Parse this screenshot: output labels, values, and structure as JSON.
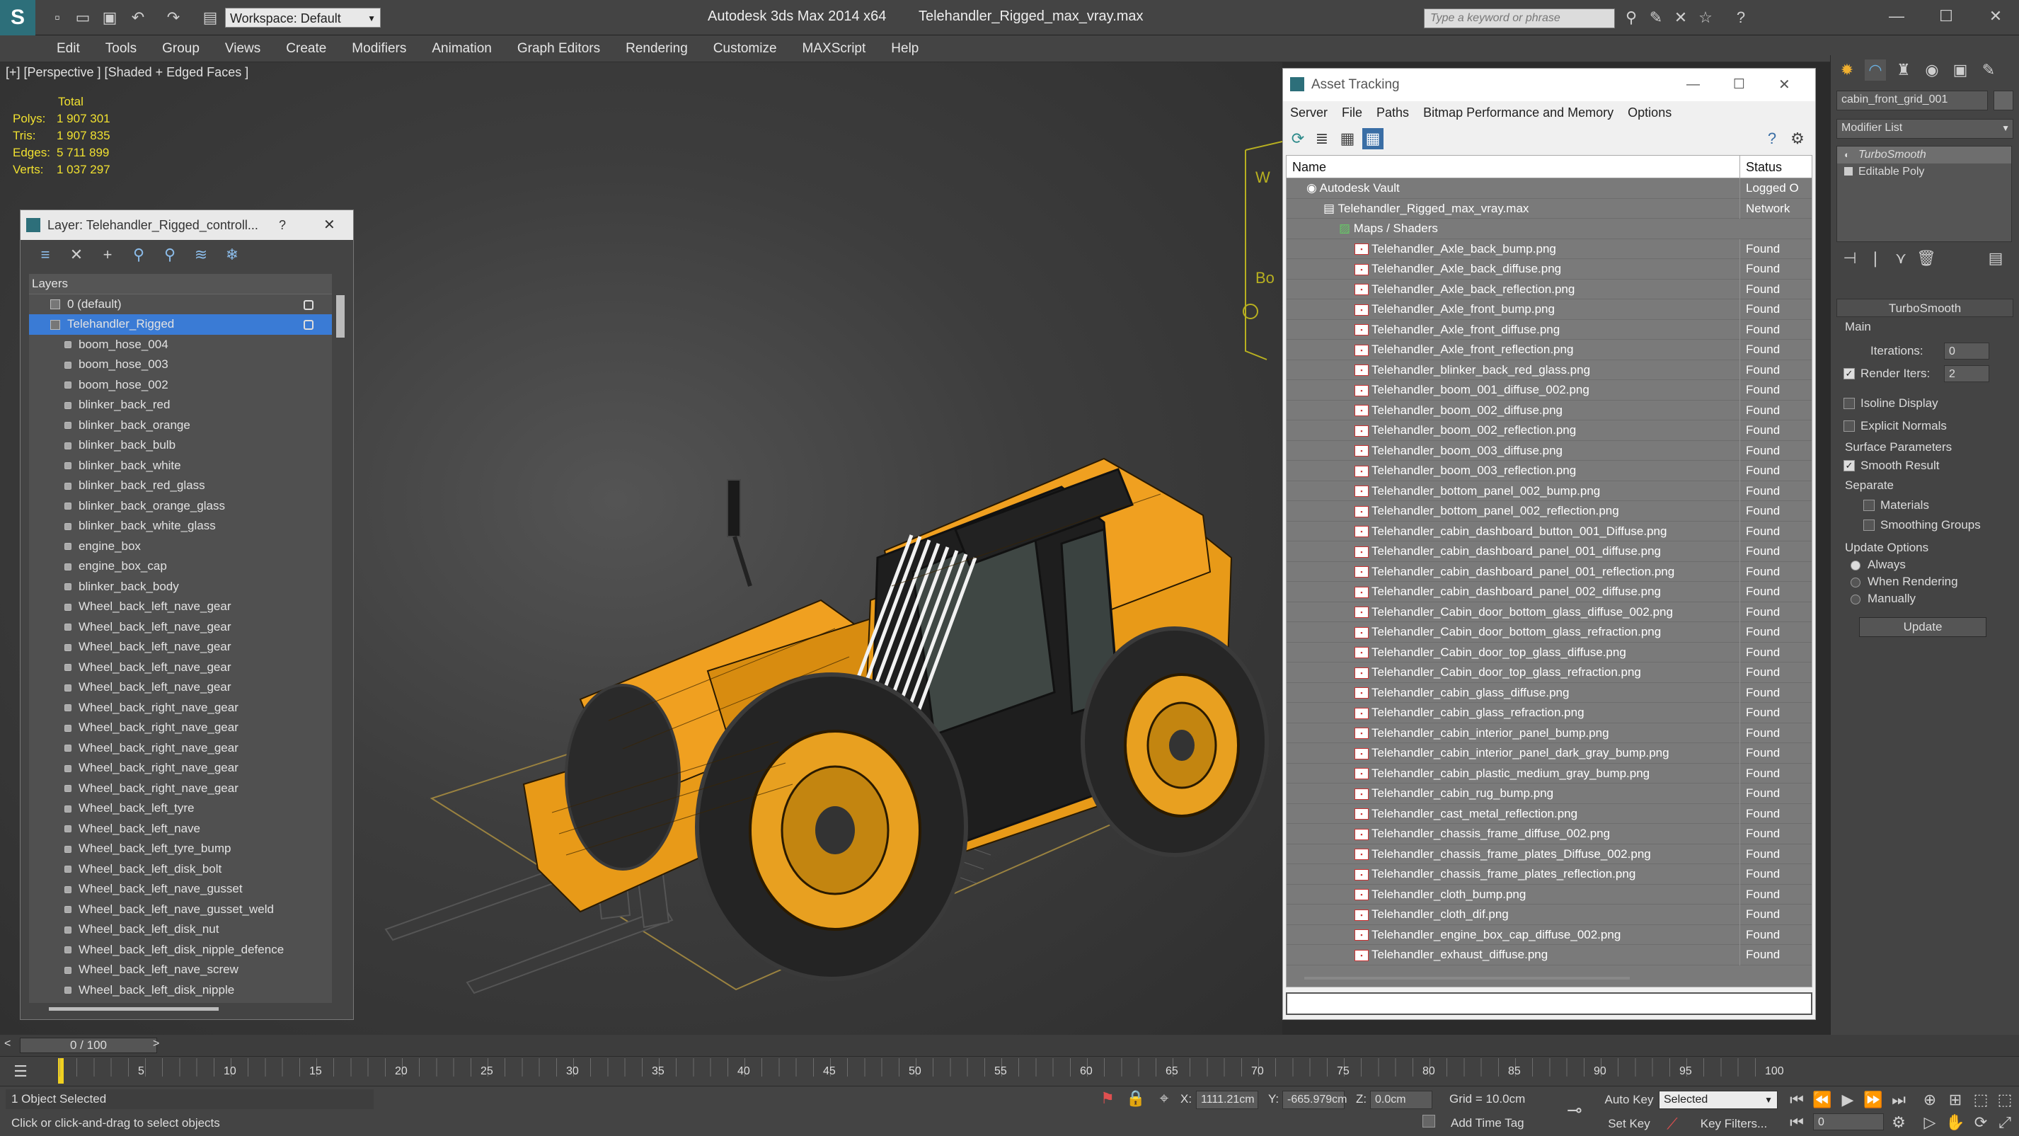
{
  "app": {
    "title": "Autodesk 3ds Max  2014 x64",
    "file": "Telehandler_Rigged_max_vray.max",
    "workspace": "Workspace: Default",
    "search_placeholder": "Type a keyword or phrase"
  },
  "menus": [
    "Edit",
    "Tools",
    "Group",
    "Views",
    "Create",
    "Modifiers",
    "Animation",
    "Graph Editors",
    "Rendering",
    "Customize",
    "MAXScript",
    "Help"
  ],
  "viewport": {
    "label": "[+] [Perspective ] [Shaded + Edged Faces ]",
    "stats_header": "Total",
    "stats": [
      {
        "k": "Polys:",
        "v": "1 907 301"
      },
      {
        "k": "Tris:",
        "v": "1 907 835"
      },
      {
        "k": "Edges:",
        "v": "5 711 899"
      },
      {
        "k": "Verts:",
        "v": "1 037 297"
      }
    ]
  },
  "layer_panel": {
    "title": "Layer: Telehandler_Rigged_controll...",
    "help": "?",
    "header": "Layers",
    "rows": [
      {
        "label": "0 (default)",
        "level": 0,
        "selected": false
      },
      {
        "label": "Telehandler_Rigged",
        "level": 0,
        "selected": true
      },
      {
        "label": "boom_hose_004",
        "level": 1
      },
      {
        "label": "boom_hose_003",
        "level": 1
      },
      {
        "label": "boom_hose_002",
        "level": 1
      },
      {
        "label": "blinker_back_red",
        "level": 1
      },
      {
        "label": "blinker_back_orange",
        "level": 1
      },
      {
        "label": "blinker_back_bulb",
        "level": 1
      },
      {
        "label": "blinker_back_white",
        "level": 1
      },
      {
        "label": "blinker_back_red_glass",
        "level": 1
      },
      {
        "label": "blinker_back_orange_glass",
        "level": 1
      },
      {
        "label": "blinker_back_white_glass",
        "level": 1
      },
      {
        "label": "engine_box",
        "level": 1
      },
      {
        "label": "engine_box_cap",
        "level": 1
      },
      {
        "label": "blinker_back_body",
        "level": 1
      },
      {
        "label": "Wheel_back_left_nave_gear",
        "level": 1
      },
      {
        "label": "Wheel_back_left_nave_gear",
        "level": 1
      },
      {
        "label": "Wheel_back_left_nave_gear",
        "level": 1
      },
      {
        "label": "Wheel_back_left_nave_gear",
        "level": 1
      },
      {
        "label": "Wheel_back_left_nave_gear",
        "level": 1
      },
      {
        "label": "Wheel_back_right_nave_gear",
        "level": 1
      },
      {
        "label": "Wheel_back_right_nave_gear",
        "level": 1
      },
      {
        "label": "Wheel_back_right_nave_gear",
        "level": 1
      },
      {
        "label": "Wheel_back_right_nave_gear",
        "level": 1
      },
      {
        "label": "Wheel_back_right_nave_gear",
        "level": 1
      },
      {
        "label": "Wheel_back_left_tyre",
        "level": 1
      },
      {
        "label": "Wheel_back_left_nave",
        "level": 1
      },
      {
        "label": "Wheel_back_left_tyre_bump",
        "level": 1
      },
      {
        "label": "Wheel_back_left_disk_bolt",
        "level": 1
      },
      {
        "label": "Wheel_back_left_nave_gusset",
        "level": 1
      },
      {
        "label": "Wheel_back_left_nave_gusset_weld",
        "level": 1
      },
      {
        "label": "Wheel_back_left_disk_nut",
        "level": 1
      },
      {
        "label": "Wheel_back_left_disk_nipple_defence",
        "level": 1
      },
      {
        "label": "Wheel_back_left_nave_screw",
        "level": 1
      },
      {
        "label": "Wheel_back_left_disk_nipple",
        "level": 1
      }
    ]
  },
  "asset_tracking": {
    "title": "Asset Tracking",
    "menus": [
      "Server",
      "File",
      "Paths",
      "Bitmap Performance and Memory",
      "Options"
    ],
    "col_name": "Name",
    "col_status": "Status",
    "rows": [
      {
        "name": "Autodesk Vault",
        "status": "Logged O",
        "level": 0,
        "kind": "vault"
      },
      {
        "name": "Telehandler_Rigged_max_vray.max",
        "status": "Network",
        "level": 1,
        "kind": "file"
      },
      {
        "name": "Maps / Shaders",
        "status": "",
        "level": 2,
        "kind": "maps"
      },
      {
        "name": "Telehandler_Axle_back_bump.png",
        "status": "Found",
        "level": 3,
        "kind": "png"
      },
      {
        "name": "Telehandler_Axle_back_diffuse.png",
        "status": "Found",
        "level": 3,
        "kind": "png"
      },
      {
        "name": "Telehandler_Axle_back_reflection.png",
        "status": "Found",
        "level": 3,
        "kind": "png"
      },
      {
        "name": "Telehandler_Axle_front_bump.png",
        "status": "Found",
        "level": 3,
        "kind": "png"
      },
      {
        "name": "Telehandler_Axle_front_diffuse.png",
        "status": "Found",
        "level": 3,
        "kind": "png"
      },
      {
        "name": "Telehandler_Axle_front_reflection.png",
        "status": "Found",
        "level": 3,
        "kind": "png"
      },
      {
        "name": "Telehandler_blinker_back_red_glass.png",
        "status": "Found",
        "level": 3,
        "kind": "png"
      },
      {
        "name": "Telehandler_boom_001_diffuse_002.png",
        "status": "Found",
        "level": 3,
        "kind": "png"
      },
      {
        "name": "Telehandler_boom_002_diffuse.png",
        "status": "Found",
        "level": 3,
        "kind": "png"
      },
      {
        "name": "Telehandler_boom_002_reflection.png",
        "status": "Found",
        "level": 3,
        "kind": "png"
      },
      {
        "name": "Telehandler_boom_003_diffuse.png",
        "status": "Found",
        "level": 3,
        "kind": "png"
      },
      {
        "name": "Telehandler_boom_003_reflection.png",
        "status": "Found",
        "level": 3,
        "kind": "png"
      },
      {
        "name": "Telehandler_bottom_panel_002_bump.png",
        "status": "Found",
        "level": 3,
        "kind": "png"
      },
      {
        "name": "Telehandler_bottom_panel_002_reflection.png",
        "status": "Found",
        "level": 3,
        "kind": "png"
      },
      {
        "name": "Telehandler_cabin_dashboard_button_001_Diffuse.png",
        "status": "Found",
        "level": 3,
        "kind": "png"
      },
      {
        "name": "Telehandler_cabin_dashboard_panel_001_diffuse.png",
        "status": "Found",
        "level": 3,
        "kind": "png"
      },
      {
        "name": "Telehandler_cabin_dashboard_panel_001_reflection.png",
        "status": "Found",
        "level": 3,
        "kind": "png"
      },
      {
        "name": "Telehandler_cabin_dashboard_panel_002_diffuse.png",
        "status": "Found",
        "level": 3,
        "kind": "png"
      },
      {
        "name": "Telehandler_Cabin_door_bottom_glass_diffuse_002.png",
        "status": "Found",
        "level": 3,
        "kind": "png"
      },
      {
        "name": "Telehandler_Cabin_door_bottom_glass_refraction.png",
        "status": "Found",
        "level": 3,
        "kind": "png"
      },
      {
        "name": "Telehandler_Cabin_door_top_glass_diffuse.png",
        "status": "Found",
        "level": 3,
        "kind": "png"
      },
      {
        "name": "Telehandler_Cabin_door_top_glass_refraction.png",
        "status": "Found",
        "level": 3,
        "kind": "png"
      },
      {
        "name": "Telehandler_cabin_glass_diffuse.png",
        "status": "Found",
        "level": 3,
        "kind": "png"
      },
      {
        "name": "Telehandler_cabin_glass_refraction.png",
        "status": "Found",
        "level": 3,
        "kind": "png"
      },
      {
        "name": "Telehandler_cabin_interior_panel_bump.png",
        "status": "Found",
        "level": 3,
        "kind": "png"
      },
      {
        "name": "Telehandler_cabin_interior_panel_dark_gray_bump.png",
        "status": "Found",
        "level": 3,
        "kind": "png"
      },
      {
        "name": "Telehandler_cabin_plastic_medium_gray_bump.png",
        "status": "Found",
        "level": 3,
        "kind": "png"
      },
      {
        "name": "Telehandler_cabin_rug_bump.png",
        "status": "Found",
        "level": 3,
        "kind": "png"
      },
      {
        "name": "Telehandler_cast_metal_reflection.png",
        "status": "Found",
        "level": 3,
        "kind": "png"
      },
      {
        "name": "Telehandler_chassis_frame_diffuse_002.png",
        "status": "Found",
        "level": 3,
        "kind": "png"
      },
      {
        "name": "Telehandler_chassis_frame_plates_Diffuse_002.png",
        "status": "Found",
        "level": 3,
        "kind": "png"
      },
      {
        "name": "Telehandler_chassis_frame_plates_reflection.png",
        "status": "Found",
        "level": 3,
        "kind": "png"
      },
      {
        "name": "Telehandler_cloth_bump.png",
        "status": "Found",
        "level": 3,
        "kind": "png"
      },
      {
        "name": "Telehandler_cloth_dif.png",
        "status": "Found",
        "level": 3,
        "kind": "png"
      },
      {
        "name": "Telehandler_engine_box_cap_diffuse_002.png",
        "status": "Found",
        "level": 3,
        "kind": "png"
      },
      {
        "name": "Telehandler_exhaust_diffuse.png",
        "status": "Found",
        "level": 3,
        "kind": "png"
      }
    ]
  },
  "command_panel": {
    "object_name": "cabin_front_grid_001",
    "modifier_list": "Modifier List",
    "stack": [
      "TurboSmooth",
      "Editable Poly"
    ],
    "rollout_title": "TurboSmooth",
    "main_group": "Main",
    "iterations_label": "Iterations:",
    "iterations_value": "0",
    "render_iters_label": "Render Iters:",
    "render_iters_value": "2",
    "isoline_label": "Isoline Display",
    "explicit_label": "Explicit Normals",
    "surface_group": "Surface Parameters",
    "smooth_result": "Smooth Result",
    "separate_label": "Separate",
    "materials": "Materials",
    "smoothing_groups": "Smoothing Groups",
    "update_group": "Update Options",
    "always": "Always",
    "when_rendering": "When Rendering",
    "manually": "Manually",
    "update_button": "Update"
  },
  "timeline": {
    "frame": "0 / 100",
    "ticks": [
      "5",
      "10",
      "15",
      "20",
      "25",
      "30",
      "35",
      "40",
      "45",
      "50",
      "55",
      "60",
      "65",
      "70",
      "75",
      "80",
      "85",
      "90",
      "95",
      "100"
    ]
  },
  "status": {
    "selection": "1 Object Selected",
    "prompt": "Click or click-and-drag to select objects",
    "x_label": "X:",
    "x": "1111.21cm",
    "y_label": "Y:",
    "y": "-665.979cm",
    "z_label": "Z:",
    "z": "0.0cm",
    "grid": "Grid = 10.0cm",
    "add_time_tag": "Add Time Tag",
    "auto_key": "Auto Key",
    "set_key": "Set Key",
    "selected": "Selected",
    "key_filters": "Key Filters...",
    "frame_value": "0"
  },
  "colors": {
    "accent": "#3a7bd5",
    "machine": "#f0a020",
    "stats": "#f0e030"
  }
}
